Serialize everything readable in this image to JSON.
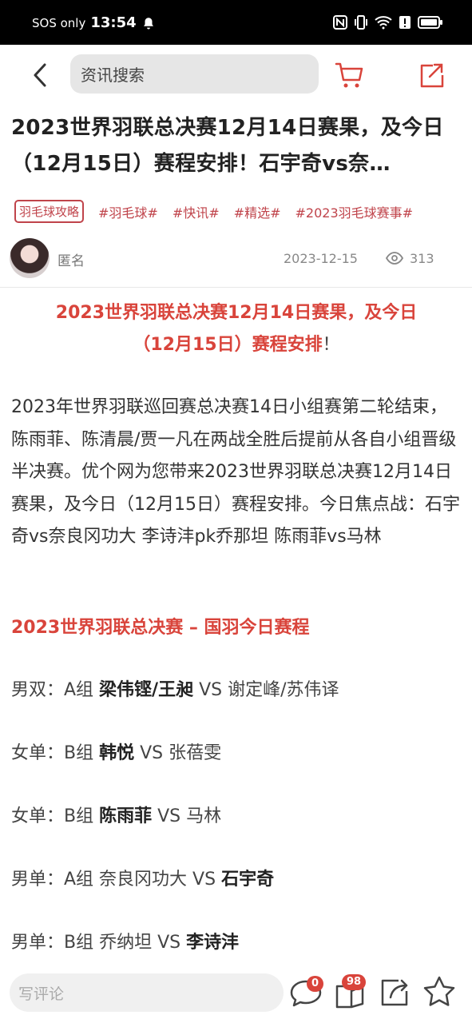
{
  "status_bar": {
    "carrier": "SOS only",
    "time": "13:54"
  },
  "topbar": {
    "search_placeholder": "资讯搜索"
  },
  "article": {
    "title": "2023世界羽联总决赛12月14日赛果，及今日（12月15日）赛程安排！石宇奇vs奈…",
    "tags": {
      "category": "羽毛球攻略",
      "hashtags": [
        "#羽毛球#",
        "#快讯#",
        "#精选#",
        "#2023羽毛球赛事#"
      ]
    },
    "author": "匿名",
    "date": "2023-12-15",
    "views": "313",
    "subtitle_line1": "2023世界羽联总决赛12月14日赛果，及今日",
    "subtitle_line2": "（12月15日）赛程安排",
    "subtitle_excl": "！",
    "paragraph": "2023年世界羽联巡回赛总决赛14日小组赛第二轮结束，陈雨菲、陈清晨/贾一凡在两战全胜后提前从各自小组晋级半决赛。优个网为您带来2023世界羽联总决赛12月14日赛果，及今日（12月15日）赛程安排。今日焦点战：石宇奇vs奈良冈功大 李诗沣pk乔那坦 陈雨菲vs马林",
    "section_heading": "2023世界羽联总决赛 – 国羽今日赛程",
    "matches": [
      {
        "prefix": "男双：A组 ",
        "bold_a": "梁伟铿/王昶",
        "vs": " VS ",
        "b": "谢定峰/苏伟译",
        "bold_b": ""
      },
      {
        "prefix": "女单：B组 ",
        "bold_a": "韩悦",
        "vs": " VS ",
        "b": "张蓓雯",
        "bold_b": ""
      },
      {
        "prefix": "女单：B组 ",
        "bold_a": "陈雨菲",
        "vs": " VS ",
        "b": "马林",
        "bold_b": ""
      },
      {
        "prefix": "男单：A组 ",
        "bold_a": "",
        "vs": "奈良冈功大 VS ",
        "b": "",
        "bold_b": "石宇奇"
      },
      {
        "prefix": "男单：B组 ",
        "bold_a": "",
        "vs": "乔纳坦 VS ",
        "b": "",
        "bold_b": "李诗沣"
      }
    ]
  },
  "bottom_bar": {
    "comment_placeholder": "写评论",
    "comment_count": "0",
    "collect_count": "98"
  },
  "colors": {
    "accent": "#d9443b",
    "tag": "#c0444b"
  }
}
